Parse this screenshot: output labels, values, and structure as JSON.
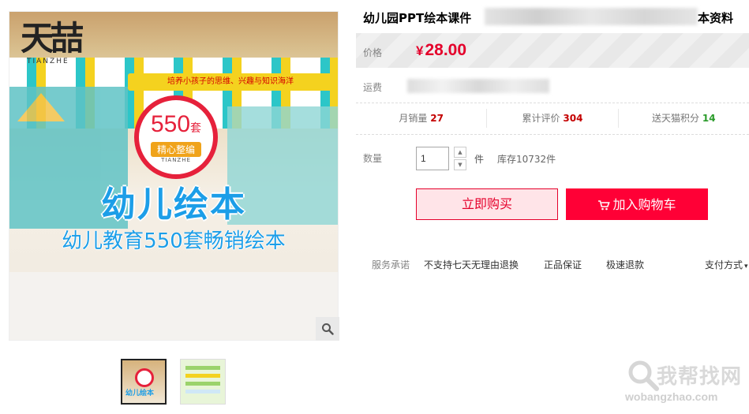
{
  "gallery": {
    "logo_text": "天喆",
    "logo_sub": "TIANZHE",
    "banner_text": "培养小孩子的思维、兴趣与知识海洋",
    "badge_number": "550",
    "badge_unit": "套",
    "badge_ribbon": "精心整编",
    "badge_en": "TIANZHE",
    "headline": "幼儿绘本",
    "subheadline": "幼儿教育550套畅销绘本",
    "thumb1_text": "幼儿绘本"
  },
  "product": {
    "title_prefix": "幼儿园PPT绘本课件 ",
    "title_suffix": "本资料",
    "price_label": "价格",
    "price_currency": "¥",
    "price_value": "28.00",
    "shipping_label": "运费"
  },
  "stats": [
    {
      "label": "月销量",
      "value": "27"
    },
    {
      "label": "累计评价",
      "value": "304"
    },
    {
      "label": "送天猫积分",
      "value": "14"
    }
  ],
  "purchase": {
    "qty_label": "数量",
    "qty_value": "1",
    "unit": "件",
    "stock": "库存10732件",
    "buy_now": "立即购买",
    "add_cart": "加入购物车"
  },
  "service": {
    "label": "服务承诺",
    "items": [
      "不支持七天无理由退换",
      "正品保证",
      "极速退款"
    ],
    "payment": "支付方式"
  },
  "watermark": {
    "cn": "我帮找网",
    "en": "wobangzhao.com"
  },
  "colors": {
    "accent": "#ff0036",
    "price": "#e4002b",
    "headline": "#1c9ee8"
  }
}
